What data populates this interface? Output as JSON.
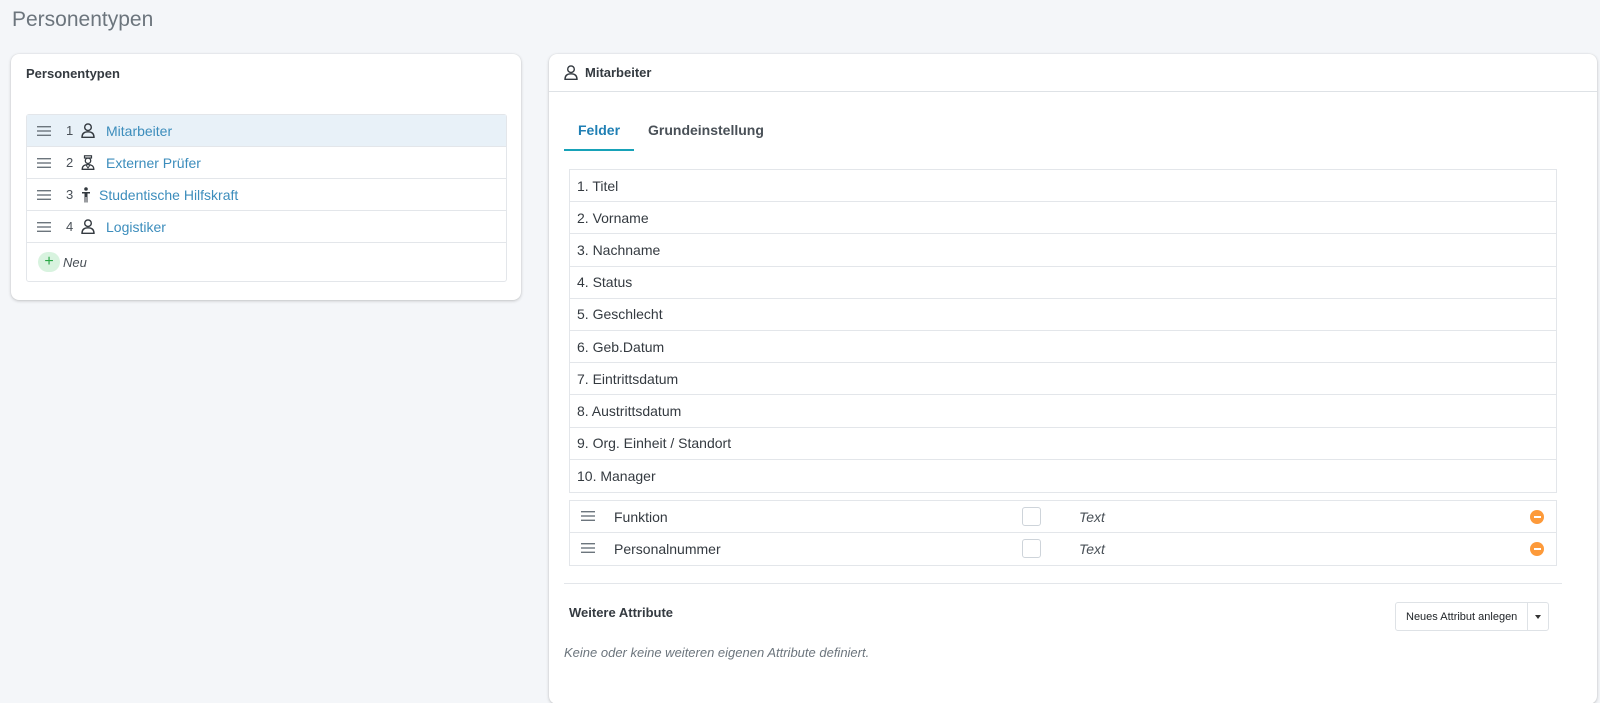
{
  "page": {
    "title": "Personentypen"
  },
  "left_panel": {
    "title": "Personentypen",
    "items": [
      {
        "number": "1",
        "icon": "user-icon",
        "label": "Mitarbeiter"
      },
      {
        "number": "2",
        "icon": "inspector-icon",
        "label": "Externer Prüfer"
      },
      {
        "number": "3",
        "icon": "person-standing-icon",
        "label": "Studentische Hilfskraft"
      },
      {
        "number": "4",
        "icon": "user-icon",
        "label": "Logistiker"
      }
    ],
    "new_label": "Neu",
    "new_symbol": "+"
  },
  "right_panel": {
    "title": "Mitarbeiter",
    "tabs": [
      {
        "label": "Felder"
      },
      {
        "label": "Grundeinstellung"
      }
    ],
    "fields": [
      "1. Titel",
      "2. Vorname",
      "3. Nachname",
      "4. Status",
      "5. Geschlecht",
      "6. Geb.Datum",
      "7. Eintrittsdatum",
      "8. Austrittsdatum",
      "9. Org. Einheit / Standort",
      "10. Manager"
    ],
    "custom_fields": [
      {
        "label": "Funktion",
        "type": "Text"
      },
      {
        "label": "Personalnummer",
        "type": "Text"
      }
    ],
    "attributes": {
      "title": "Weitere Attribute",
      "button_label": "Neues Attribut anlegen",
      "empty_note": "Keine oder keine weiteren eigenen Attribute definiert."
    }
  },
  "colors": {
    "link": "#3c8dbc",
    "active_row_bg": "#e8f1f8",
    "tab_accent": "#17a2b8",
    "remove_button": "#fd9a3a",
    "add_button_bg": "#d8f3df"
  }
}
